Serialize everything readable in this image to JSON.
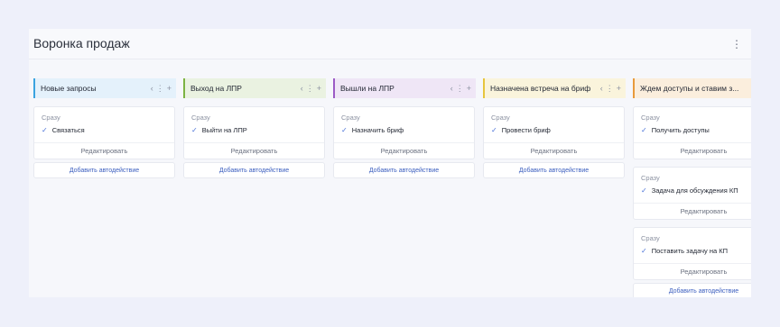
{
  "board": {
    "title": "Воронка продаж",
    "menu_icon": "⋮"
  },
  "columns": [
    {
      "title": "Новые запросы",
      "accent": "#3aa3e0",
      "head_bg": "#e4f1fb",
      "cards": [
        {
          "when": "Сразу",
          "action": "Связаться",
          "edit": "Редактировать"
        }
      ],
      "add_label": "Добавить автодействие"
    },
    {
      "title": "Выход на ЛПР",
      "accent": "#7cb342",
      "head_bg": "#eaf2e1",
      "cards": [
        {
          "when": "Сразу",
          "action": "Выйти на ЛПР",
          "edit": "Редактировать"
        }
      ],
      "add_label": "Добавить автодействие"
    },
    {
      "title": "Вышли на ЛПР",
      "accent": "#9c5bc6",
      "head_bg": "#efe6f6",
      "cards": [
        {
          "when": "Сразу",
          "action": "Назначить бриф",
          "edit": "Редактировать"
        }
      ],
      "add_label": "Добавить автодействие"
    },
    {
      "title": "Назначена встреча на бриф",
      "accent": "#e6c53d",
      "head_bg": "#faf4dc",
      "cards": [
        {
          "when": "Сразу",
          "action": "Провести бриф",
          "edit": "Редактировать"
        }
      ],
      "add_label": "Добавить автодействие"
    },
    {
      "title": "Ждем доступы и ставим з...",
      "accent": "#e89a3c",
      "head_bg": "#fbeedd",
      "cards": [
        {
          "when": "Сразу",
          "action": "Получить доступы",
          "edit": "Редактировать"
        },
        {
          "when": "Сразу",
          "action": "Задача для обсуждения КП",
          "edit": "Редактировать"
        },
        {
          "when": "Сразу",
          "action": "Поставить задачу на КП",
          "edit": "Редактировать"
        }
      ],
      "add_label": "Добавить автодействие"
    }
  ],
  "icons": {
    "prev": "‹",
    "more": "⋮",
    "add": "+",
    "check": "✓",
    "next": "›"
  }
}
